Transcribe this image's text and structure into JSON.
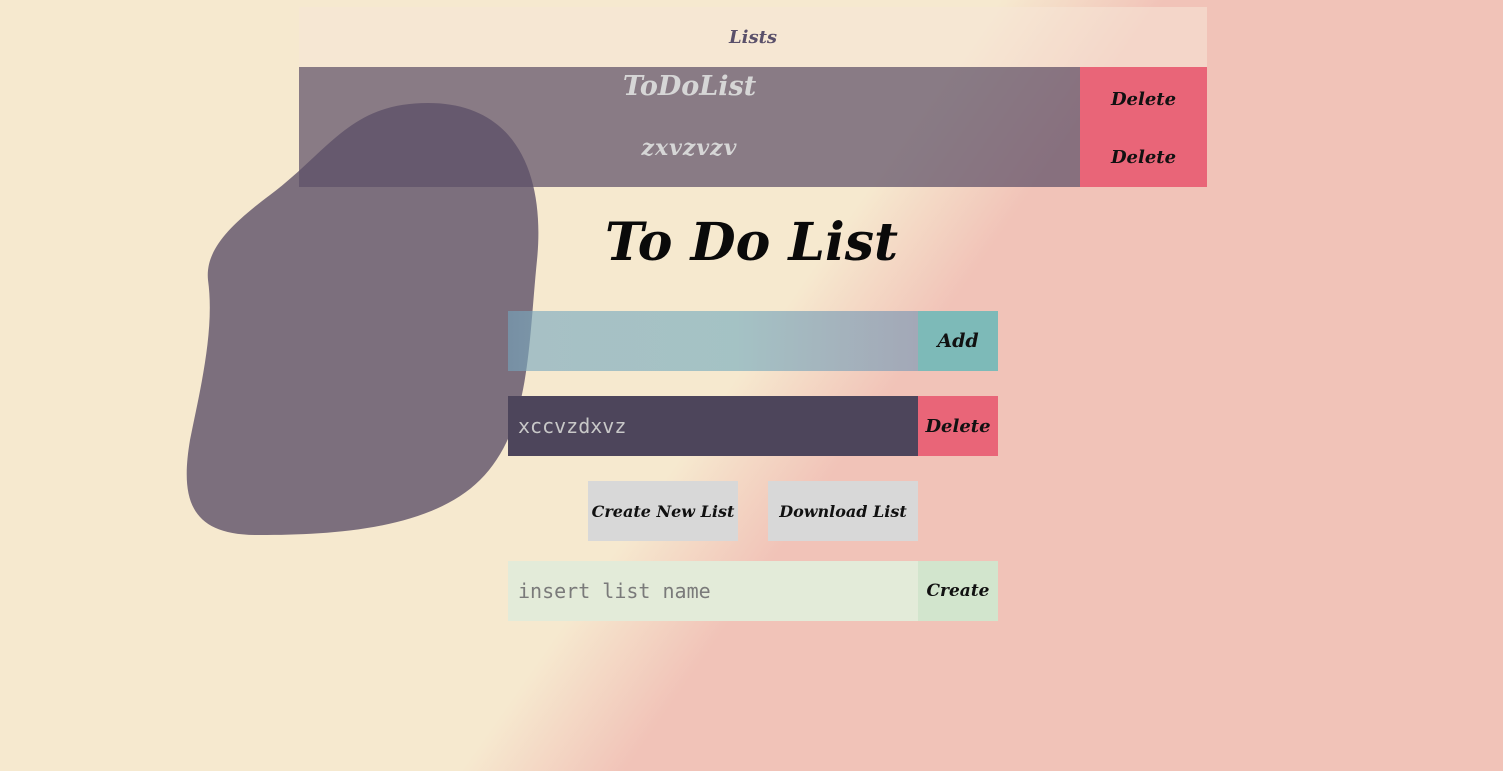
{
  "lists_panel": {
    "header": "Lists",
    "items": [
      {
        "name": "ToDoList",
        "delete_label": "Delete"
      },
      {
        "name": "zxvzvzv",
        "delete_label": "Delete"
      }
    ]
  },
  "title": "To Do List",
  "add_form": {
    "input_value": "",
    "add_label": "Add"
  },
  "todos": [
    {
      "text": "xccvzdxvz",
      "delete_label": "Delete"
    }
  ],
  "actions": {
    "create_new_list_label": "Create New List",
    "download_list_label": "Download List"
  },
  "create_form": {
    "placeholder": "insert list name",
    "create_label": "Create"
  },
  "colors": {
    "background_left": "#f6e9cf",
    "background_right": "#f1c3b8",
    "blob": "#5e5068",
    "delete": "#e96578",
    "add": "#7dbab8",
    "todo_item": "#4d455b",
    "create": "#d2e5cd"
  }
}
